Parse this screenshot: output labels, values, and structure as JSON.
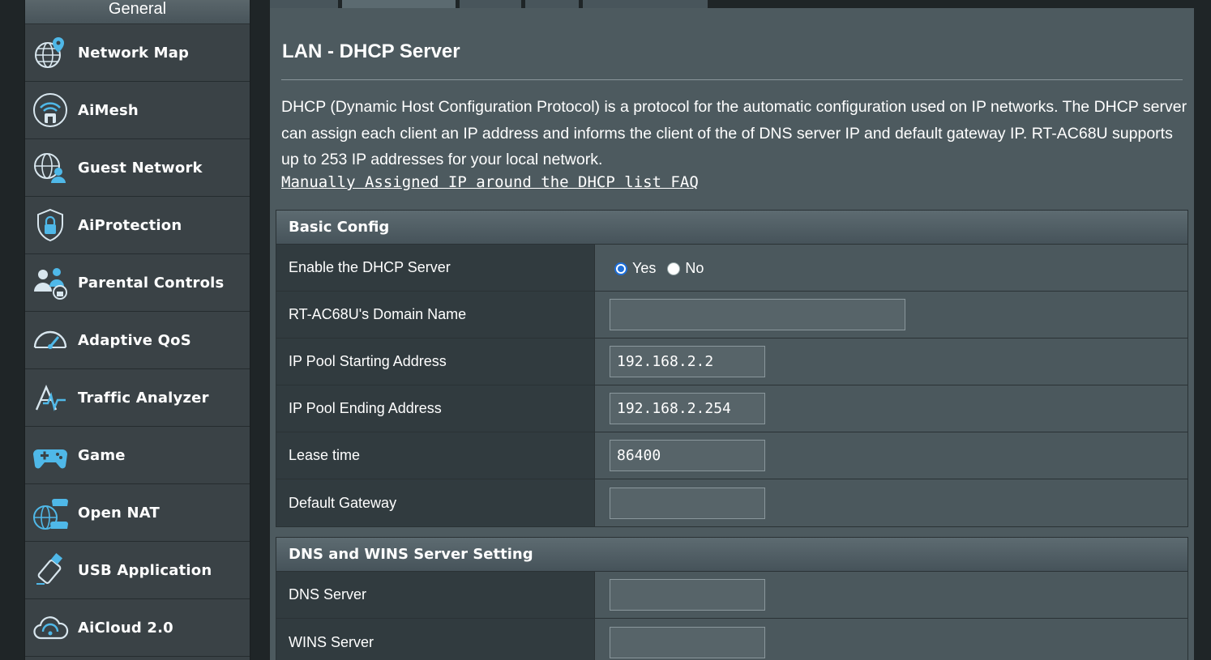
{
  "sidebar": {
    "header": "General",
    "items": [
      {
        "label": "Network Map",
        "icon": "network-map-icon"
      },
      {
        "label": "AiMesh",
        "icon": "aimesh-icon"
      },
      {
        "label": "Guest Network",
        "icon": "guest-network-icon"
      },
      {
        "label": "AiProtection",
        "icon": "aiprotection-icon"
      },
      {
        "label": "Parental Controls",
        "icon": "parental-controls-icon"
      },
      {
        "label": "Adaptive QoS",
        "icon": "adaptive-qos-icon"
      },
      {
        "label": "Traffic Analyzer",
        "icon": "traffic-analyzer-icon"
      },
      {
        "label": "Game",
        "icon": "game-icon"
      },
      {
        "label": "Open NAT",
        "icon": "open-nat-icon"
      },
      {
        "label": "USB Application",
        "icon": "usb-application-icon"
      },
      {
        "label": "AiCloud 2.0",
        "icon": "aicloud-icon"
      }
    ]
  },
  "main": {
    "title": "LAN - DHCP Server",
    "description": "DHCP (Dynamic Host Configuration Protocol) is a protocol for the automatic configuration used on IP networks. The DHCP server can assign each client an IP address and informs the client of the of DNS server IP and default gateway IP. RT-AC68U supports up to 253 IP addresses for your local network.",
    "faq_link": "Manually Assigned IP around the DHCP list FAQ",
    "basic_config": {
      "header": "Basic Config",
      "enable_label": "Enable the DHCP Server",
      "yes_label": "Yes",
      "no_label": "No",
      "domain_label": "RT-AC68U's Domain Name",
      "domain_value": "",
      "start_label": "IP Pool Starting Address",
      "start_value": "192.168.2.2",
      "end_label": "IP Pool Ending Address",
      "end_value": "192.168.2.254",
      "lease_label": "Lease time",
      "lease_value": "86400",
      "gateway_label": "Default Gateway",
      "gateway_value": ""
    },
    "dns_wins": {
      "header": "DNS and WINS Server Setting",
      "dns_label": "DNS Server",
      "dns_value": "",
      "wins_label": "WINS Server",
      "wins_value": ""
    }
  },
  "colors": {
    "accent_icon": "#4fb8e8",
    "radio_checked": "#1e6fd9"
  }
}
